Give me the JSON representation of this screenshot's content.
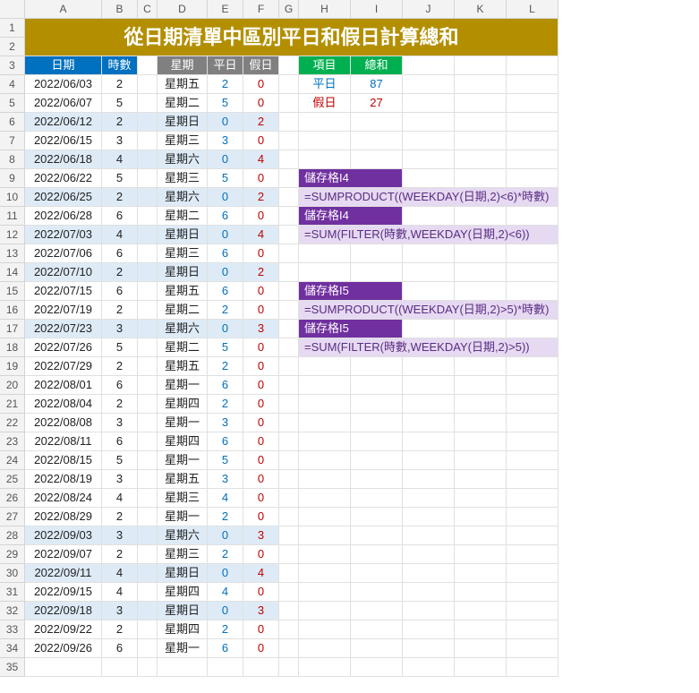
{
  "columns": [
    "A",
    "B",
    "C",
    "D",
    "E",
    "F",
    "G",
    "H",
    "I",
    "J",
    "K",
    "L"
  ],
  "rowCount": 35,
  "title": "從日期清單中區別平日和假日計算總和",
  "headers": {
    "date": "日期",
    "hours": "時數",
    "weekday": "星期",
    "wd": "平日",
    "we": "假日",
    "item": "項目",
    "sum": "總和"
  },
  "summary": [
    {
      "label": "平日",
      "value": "87",
      "cls": "c-blue"
    },
    {
      "label": "假日",
      "value": "27",
      "cls": "c-red"
    }
  ],
  "notes": [
    {
      "row": 9,
      "type": "hdr",
      "text": "儲存格I4"
    },
    {
      "row": 10,
      "type": "body",
      "text": "=SUMPRODUCT((WEEKDAY(日期,2)<6)*時數)"
    },
    {
      "row": 11,
      "type": "hdr",
      "text": "儲存格I4"
    },
    {
      "row": 12,
      "type": "body",
      "text": "=SUM(FILTER(時數,WEEKDAY(日期,2)<6))"
    },
    {
      "row": 15,
      "type": "hdr",
      "text": "儲存格I5"
    },
    {
      "row": 16,
      "type": "body",
      "text": "=SUMPRODUCT((WEEKDAY(日期,2)>5)*時數)"
    },
    {
      "row": 17,
      "type": "hdr",
      "text": "儲存格I5"
    },
    {
      "row": 18,
      "type": "body",
      "text": "=SUM(FILTER(時數,WEEKDAY(日期,2)>5))"
    }
  ],
  "rows": [
    {
      "date": "2022/06/03",
      "hours": "2",
      "wk": "星期五",
      "wd": "2",
      "we": "0",
      "wkend": false
    },
    {
      "date": "2022/06/07",
      "hours": "5",
      "wk": "星期二",
      "wd": "5",
      "we": "0",
      "wkend": false
    },
    {
      "date": "2022/06/12",
      "hours": "2",
      "wk": "星期日",
      "wd": "0",
      "we": "2",
      "wkend": true
    },
    {
      "date": "2022/06/15",
      "hours": "3",
      "wk": "星期三",
      "wd": "3",
      "we": "0",
      "wkend": false
    },
    {
      "date": "2022/06/18",
      "hours": "4",
      "wk": "星期六",
      "wd": "0",
      "we": "4",
      "wkend": true
    },
    {
      "date": "2022/06/22",
      "hours": "5",
      "wk": "星期三",
      "wd": "5",
      "we": "0",
      "wkend": false
    },
    {
      "date": "2022/06/25",
      "hours": "2",
      "wk": "星期六",
      "wd": "0",
      "we": "2",
      "wkend": true
    },
    {
      "date": "2022/06/28",
      "hours": "6",
      "wk": "星期二",
      "wd": "6",
      "we": "0",
      "wkend": false
    },
    {
      "date": "2022/07/03",
      "hours": "4",
      "wk": "星期日",
      "wd": "0",
      "we": "4",
      "wkend": true
    },
    {
      "date": "2022/07/06",
      "hours": "6",
      "wk": "星期三",
      "wd": "6",
      "we": "0",
      "wkend": false
    },
    {
      "date": "2022/07/10",
      "hours": "2",
      "wk": "星期日",
      "wd": "0",
      "we": "2",
      "wkend": true
    },
    {
      "date": "2022/07/15",
      "hours": "6",
      "wk": "星期五",
      "wd": "6",
      "we": "0",
      "wkend": false
    },
    {
      "date": "2022/07/19",
      "hours": "2",
      "wk": "星期二",
      "wd": "2",
      "we": "0",
      "wkend": false
    },
    {
      "date": "2022/07/23",
      "hours": "3",
      "wk": "星期六",
      "wd": "0",
      "we": "3",
      "wkend": true
    },
    {
      "date": "2022/07/26",
      "hours": "5",
      "wk": "星期二",
      "wd": "5",
      "we": "0",
      "wkend": false
    },
    {
      "date": "2022/07/29",
      "hours": "2",
      "wk": "星期五",
      "wd": "2",
      "we": "0",
      "wkend": false
    },
    {
      "date": "2022/08/01",
      "hours": "6",
      "wk": "星期一",
      "wd": "6",
      "we": "0",
      "wkend": false
    },
    {
      "date": "2022/08/04",
      "hours": "2",
      "wk": "星期四",
      "wd": "2",
      "we": "0",
      "wkend": false
    },
    {
      "date": "2022/08/08",
      "hours": "3",
      "wk": "星期一",
      "wd": "3",
      "we": "0",
      "wkend": false
    },
    {
      "date": "2022/08/11",
      "hours": "6",
      "wk": "星期四",
      "wd": "6",
      "we": "0",
      "wkend": false
    },
    {
      "date": "2022/08/15",
      "hours": "5",
      "wk": "星期一",
      "wd": "5",
      "we": "0",
      "wkend": false
    },
    {
      "date": "2022/08/19",
      "hours": "3",
      "wk": "星期五",
      "wd": "3",
      "we": "0",
      "wkend": false
    },
    {
      "date": "2022/08/24",
      "hours": "4",
      "wk": "星期三",
      "wd": "4",
      "we": "0",
      "wkend": false
    },
    {
      "date": "2022/08/29",
      "hours": "2",
      "wk": "星期一",
      "wd": "2",
      "we": "0",
      "wkend": false
    },
    {
      "date": "2022/09/03",
      "hours": "3",
      "wk": "星期六",
      "wd": "0",
      "we": "3",
      "wkend": true
    },
    {
      "date": "2022/09/07",
      "hours": "2",
      "wk": "星期三",
      "wd": "2",
      "we": "0",
      "wkend": false
    },
    {
      "date": "2022/09/11",
      "hours": "4",
      "wk": "星期日",
      "wd": "0",
      "we": "4",
      "wkend": true
    },
    {
      "date": "2022/09/15",
      "hours": "4",
      "wk": "星期四",
      "wd": "4",
      "we": "0",
      "wkend": false
    },
    {
      "date": "2022/09/18",
      "hours": "3",
      "wk": "星期日",
      "wd": "0",
      "we": "3",
      "wkend": true
    },
    {
      "date": "2022/09/22",
      "hours": "2",
      "wk": "星期四",
      "wd": "2",
      "we": "0",
      "wkend": false
    },
    {
      "date": "2022/09/26",
      "hours": "6",
      "wk": "星期一",
      "wd": "6",
      "we": "0",
      "wkend": false
    }
  ]
}
